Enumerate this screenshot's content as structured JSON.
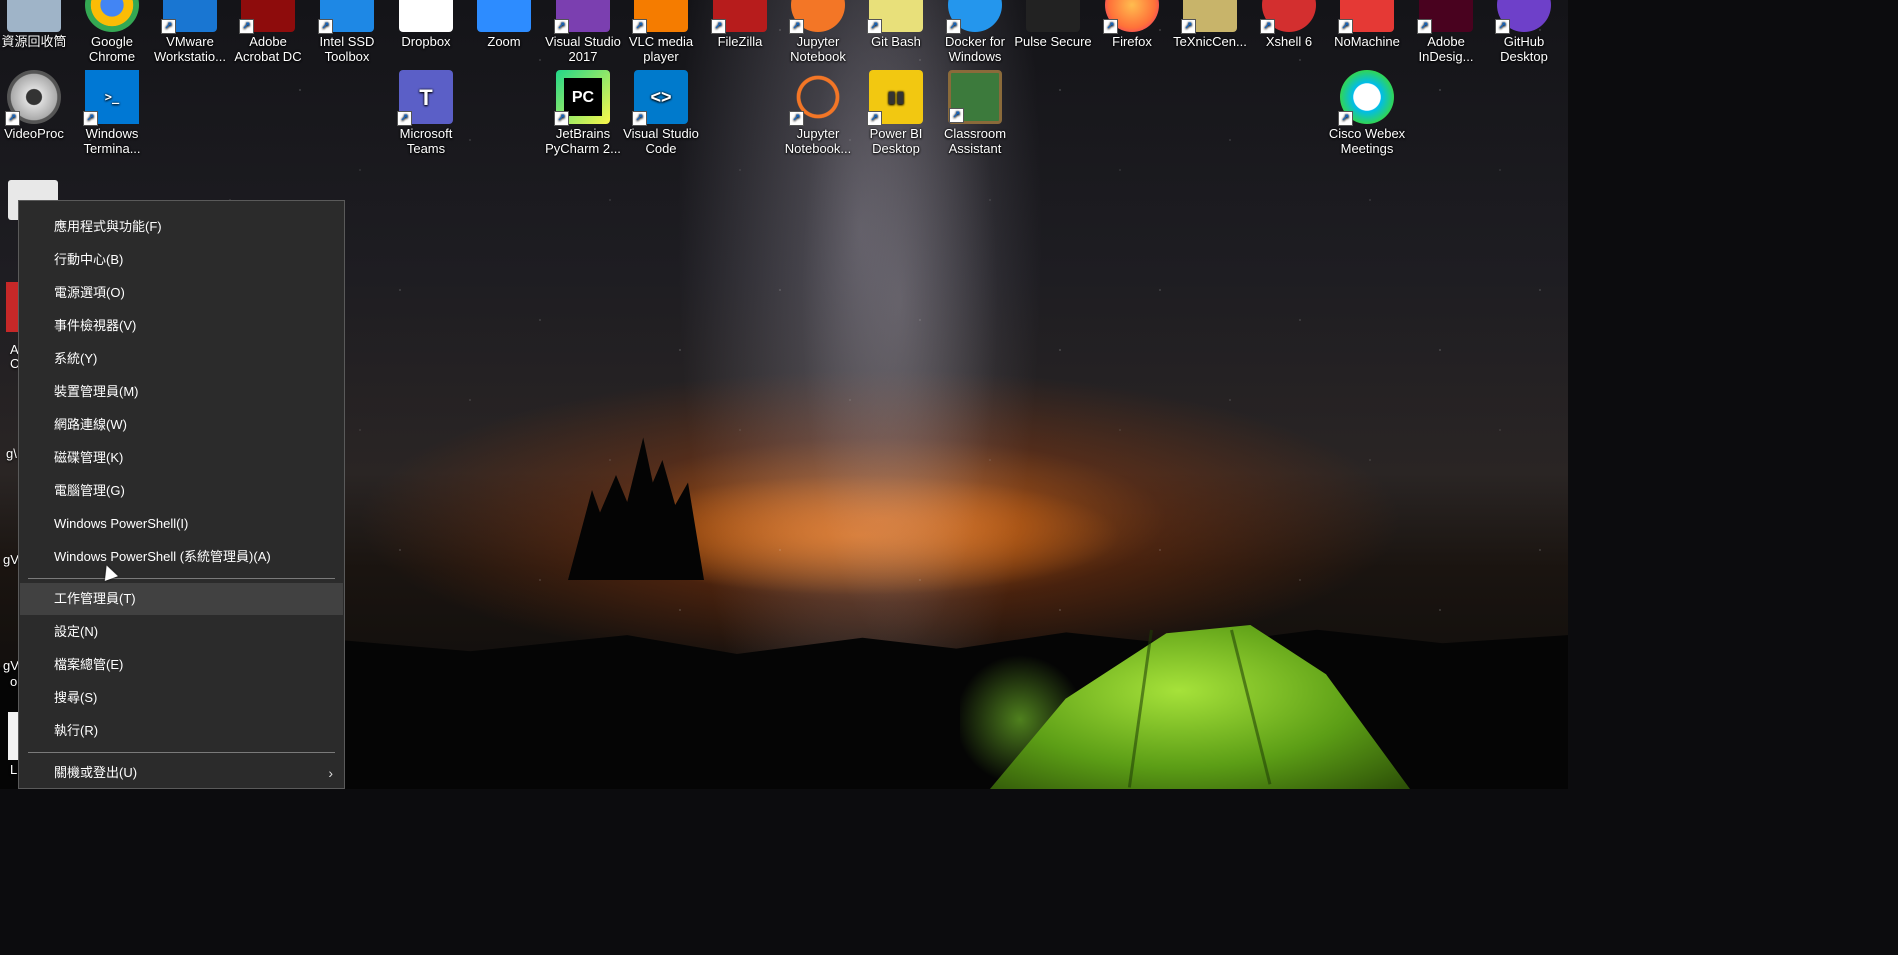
{
  "desktop": {
    "top_row": [
      {
        "label": "資源回收筒",
        "icon": "recycle-bin-icon",
        "color": "#9fb4c8"
      },
      {
        "label": "Google Chrome",
        "icon": "chrome-icon",
        "color": "#e53935"
      },
      {
        "label": "VMware Workstatio...",
        "icon": "vmware-icon",
        "color": "#1976d2"
      },
      {
        "label": "Adobe Acrobat DC",
        "icon": "acrobat-icon",
        "color": "#8e0c0c"
      },
      {
        "label": "Intel SSD Toolbox",
        "icon": "intel-ssd-icon",
        "color": "#1e88e5"
      },
      {
        "label": "Dropbox",
        "icon": "dropbox-icon",
        "color": "#ffffff"
      },
      {
        "label": "Zoom",
        "icon": "zoom-icon",
        "color": "#2d8cff"
      },
      {
        "label": "Visual Studio 2017",
        "icon": "visual-studio-icon",
        "color": "#7b3fb0"
      },
      {
        "label": "VLC media player",
        "icon": "vlc-icon",
        "color": "#f57c00"
      },
      {
        "label": "FileZilla",
        "icon": "filezilla-icon",
        "color": "#b71c1c"
      },
      {
        "label": "Jupyter Notebook",
        "icon": "jupyter-icon",
        "color": "#f37626"
      },
      {
        "label": "Git Bash",
        "icon": "git-bash-icon",
        "color": "#e8e07a"
      },
      {
        "label": "Docker for Windows",
        "icon": "docker-icon",
        "color": "#2496ed"
      },
      {
        "label": "Pulse Secure",
        "icon": "pulse-secure-icon",
        "color": "#222222"
      },
      {
        "label": "Firefox",
        "icon": "firefox-icon",
        "color": "#ff7139"
      },
      {
        "label": "TeXnicCen...",
        "icon": "texniccenter-icon",
        "color": "#c8b46a"
      },
      {
        "label": "Xshell 6",
        "icon": "xshell-icon",
        "color": "#d32f2f"
      },
      {
        "label": "NoMachine",
        "icon": "nomachine-icon",
        "color": "#e53935"
      },
      {
        "label": "Adobe InDesig...",
        "icon": "indesign-icon",
        "color": "#49021f"
      },
      {
        "label": "GitHub Desktop",
        "icon": "github-desktop-icon",
        "color": "#6e40c9"
      }
    ],
    "second_row": [
      {
        "label": "VideoProc",
        "icon": "videoproc-icon",
        "color": "#dddddd",
        "glyph": ""
      },
      {
        "label": "Windows Termina...",
        "icon": "windows-terminal-icon",
        "color": "#0078d4",
        "glyph": ">_"
      },
      {
        "label": "Microsoft Teams",
        "icon": "teams-icon",
        "color": "#5b5fc7",
        "glyph": "T"
      },
      {
        "label": "JetBrains PyCharm 2...",
        "icon": "pycharm-icon",
        "color": "#21d789",
        "glyph": "PC"
      },
      {
        "label": "Visual Studio Code",
        "icon": "vscode-icon",
        "color": "#007acc",
        "glyph": "<>"
      },
      {
        "label": "Jupyter Notebook...",
        "icon": "jupyter-icon",
        "color": "#f37626",
        "glyph": ""
      },
      {
        "label": "Power BI Desktop",
        "icon": "power-bi-icon",
        "color": "#f2c811",
        "glyph": "▮▮"
      },
      {
        "label": "Classroom Assistant",
        "icon": "classroom-assistant-icon",
        "color": "#3c7a3c",
        "glyph": ""
      },
      {
        "label": "Cisco Webex Meetings",
        "icon": "webex-icon",
        "color": "#00bceb",
        "glyph": ""
      }
    ],
    "peek_labels": {
      "a": "A",
      "b": "C",
      "c": "g\\",
      "d": "gV",
      "e": "gV",
      "f": "o",
      "g": "L"
    }
  },
  "context_menu": {
    "items": [
      {
        "label": "應用程式與功能(F)"
      },
      {
        "label": "行動中心(B)"
      },
      {
        "label": "電源選項(O)"
      },
      {
        "label": "事件檢視器(V)"
      },
      {
        "label": "系統(Y)"
      },
      {
        "label": "裝置管理員(M)"
      },
      {
        "label": "網路連線(W)"
      },
      {
        "label": "磁碟管理(K)"
      },
      {
        "label": "電腦管理(G)"
      },
      {
        "label": "Windows PowerShell(I)"
      },
      {
        "label": "Windows PowerShell (系統管理員)(A)"
      },
      {
        "label": "工作管理員(T)"
      },
      {
        "label": "設定(N)"
      },
      {
        "label": "檔案總管(E)"
      },
      {
        "label": "搜尋(S)"
      },
      {
        "label": "執行(R)"
      },
      {
        "label": "關機或登出(U)"
      }
    ],
    "highlighted": "工作管理員(T)",
    "submenu_arrow": "›"
  },
  "colors": {
    "menu_bg": "#2b2b2b",
    "menu_highlight": "#414141",
    "tent": "#8fd12a",
    "glow": "#e66e14"
  }
}
